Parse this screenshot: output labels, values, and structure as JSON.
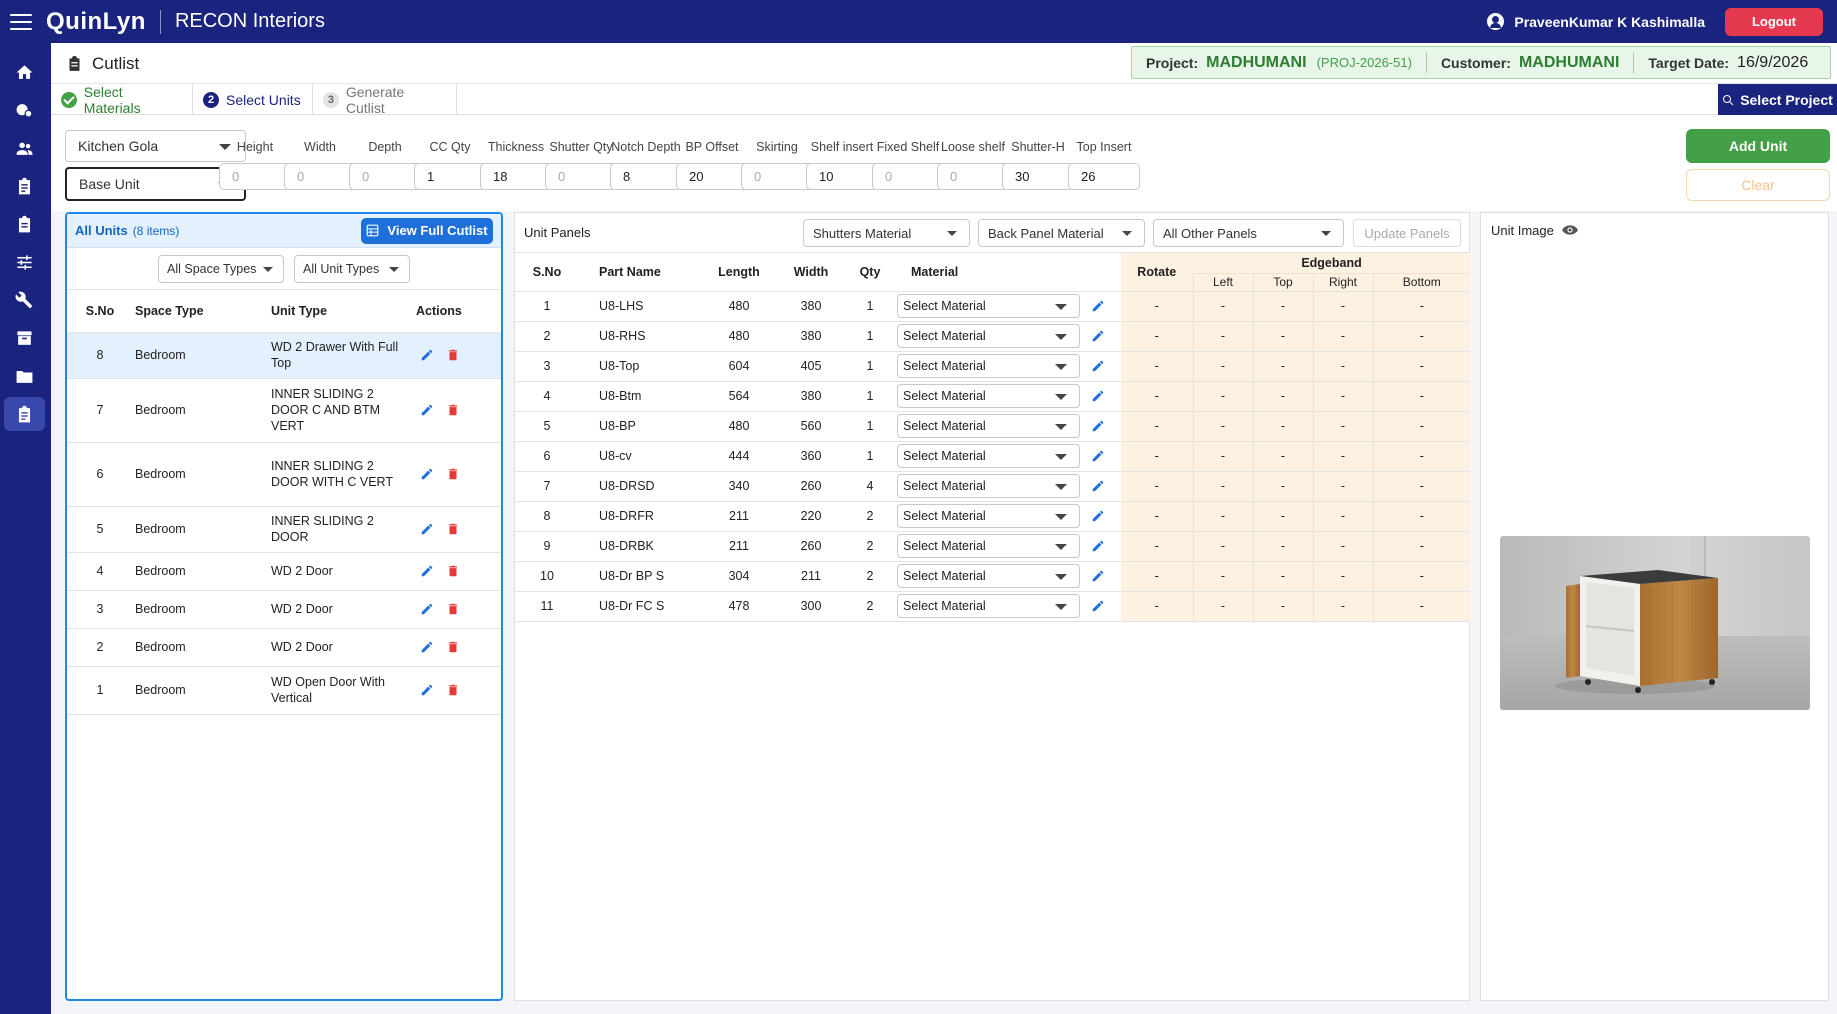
{
  "app": {
    "logo": "QuinLyn",
    "company": "RECON Interiors",
    "user": "PraveenKumar K Kashimalla",
    "logout_label": "Logout"
  },
  "page": {
    "title": "Cutlist"
  },
  "project_info": {
    "project_label": "Project:",
    "project_name": "MADHUMANI",
    "project_code": "(PROJ-2026-51)",
    "customer_label": "Customer:",
    "customer_name": "MADHUMANI",
    "target_label": "Target Date:",
    "target_date": "16/9/2026"
  },
  "steps": [
    {
      "label": "Select Materials",
      "state": "done"
    },
    {
      "num": "2",
      "label": "Select Units",
      "state": "current"
    },
    {
      "num": "3",
      "label": "Generate Cutlist",
      "state": "future"
    }
  ],
  "select_project_label": "Select Project",
  "config": {
    "category": "Kitchen Gola",
    "unit_type": "Base Unit",
    "params": [
      {
        "label": "Height",
        "value": "",
        "placeholder": "0"
      },
      {
        "label": "Width",
        "value": "",
        "placeholder": "0"
      },
      {
        "label": "Depth",
        "value": "",
        "placeholder": "0"
      },
      {
        "label": "CC Qty",
        "value": "1",
        "placeholder": ""
      },
      {
        "label": "Thickness",
        "value": "18",
        "placeholder": ""
      },
      {
        "label": "Shutter Qty",
        "value": "",
        "placeholder": "0"
      },
      {
        "label": "Notch Depth",
        "value": "8",
        "placeholder": ""
      },
      {
        "label": "BP Offset",
        "value": "20",
        "placeholder": ""
      },
      {
        "label": "Skirting",
        "value": "",
        "placeholder": "0"
      },
      {
        "label": "Shelf insert",
        "value": "10",
        "placeholder": ""
      },
      {
        "label": "Fixed Shelf",
        "value": "",
        "placeholder": "0"
      },
      {
        "label": "Loose shelf",
        "value": "",
        "placeholder": "0"
      },
      {
        "label": "Shutter-H",
        "value": "30",
        "placeholder": ""
      },
      {
        "label": "Top Insert",
        "value": "26",
        "placeholder": ""
      }
    ],
    "add_unit_label": "Add Unit",
    "clear_label": "Clear"
  },
  "units_panel": {
    "title": "All Units",
    "count": "(8 items)",
    "view_full_label": "View Full Cutlist",
    "filter_space": "All Space Types",
    "filter_unit": "All Unit Types",
    "columns": [
      "S.No",
      "Space Type",
      "Unit Type",
      "Actions"
    ],
    "rows": [
      {
        "sno": "8",
        "space": "Bedroom",
        "unit": "WD 2 Drawer With Full Top",
        "selected": true
      },
      {
        "sno": "7",
        "space": "Bedroom",
        "unit": "INNER SLIDING 2 DOOR C AND BTM VERT",
        "selected": false
      },
      {
        "sno": "6",
        "space": "Bedroom",
        "unit": "INNER SLIDING 2 DOOR WITH C VERT",
        "selected": false
      },
      {
        "sno": "5",
        "space": "Bedroom",
        "unit": "INNER SLIDING 2 DOOR",
        "selected": false
      },
      {
        "sno": "4",
        "space": "Bedroom",
        "unit": "WD 2 Door",
        "selected": false
      },
      {
        "sno": "3",
        "space": "Bedroom",
        "unit": "WD 2 Door",
        "selected": false
      },
      {
        "sno": "2",
        "space": "Bedroom",
        "unit": "WD 2 Door",
        "selected": false
      },
      {
        "sno": "1",
        "space": "Bedroom",
        "unit": "WD Open Door With Vertical",
        "selected": false
      }
    ]
  },
  "unit_panels": {
    "title": "Unit Panels",
    "shutters_dd": "Shutters Material",
    "back_panel_dd": "Back Panel Material",
    "other_dd": "All Other Panels",
    "update_label": "Update Panels",
    "columns": {
      "sno": "S.No",
      "part": "Part Name",
      "length": "Length",
      "width": "Width",
      "qty": "Qty",
      "material": "Material",
      "rotate": "Rotate",
      "edgeband": "Edgeband",
      "left": "Left",
      "top": "Top",
      "right": "Right",
      "bottom": "Bottom"
    },
    "material_placeholder": "Select Material",
    "rows": [
      {
        "sno": "1",
        "part": "U8-LHS",
        "length": "480",
        "width": "380",
        "qty": "1",
        "rotate": "-",
        "left": "-",
        "top": "-",
        "right": "-",
        "bottom": "-"
      },
      {
        "sno": "2",
        "part": "U8-RHS",
        "length": "480",
        "width": "380",
        "qty": "1",
        "rotate": "-",
        "left": "-",
        "top": "-",
        "right": "-",
        "bottom": "-"
      },
      {
        "sno": "3",
        "part": "U8-Top",
        "length": "604",
        "width": "405",
        "qty": "1",
        "rotate": "-",
        "left": "-",
        "top": "-",
        "right": "-",
        "bottom": "-"
      },
      {
        "sno": "4",
        "part": "U8-Btm",
        "length": "564",
        "width": "380",
        "qty": "1",
        "rotate": "-",
        "left": "-",
        "top": "-",
        "right": "-",
        "bottom": "-"
      },
      {
        "sno": "5",
        "part": "U8-BP",
        "length": "480",
        "width": "560",
        "qty": "1",
        "rotate": "-",
        "left": "-",
        "top": "-",
        "right": "-",
        "bottom": "-"
      },
      {
        "sno": "6",
        "part": "U8-cv",
        "length": "444",
        "width": "360",
        "qty": "1",
        "rotate": "-",
        "left": "-",
        "top": "-",
        "right": "-",
        "bottom": "-"
      },
      {
        "sno": "7",
        "part": "U8-DRSD",
        "length": "340",
        "width": "260",
        "qty": "4",
        "rotate": "-",
        "left": "-",
        "top": "-",
        "right": "-",
        "bottom": "-"
      },
      {
        "sno": "8",
        "part": "U8-DRFR",
        "length": "211",
        "width": "220",
        "qty": "2",
        "rotate": "-",
        "left": "-",
        "top": "-",
        "right": "-",
        "bottom": "-"
      },
      {
        "sno": "9",
        "part": "U8-DRBK",
        "length": "211",
        "width": "260",
        "qty": "2",
        "rotate": "-",
        "left": "-",
        "top": "-",
        "right": "-",
        "bottom": "-"
      },
      {
        "sno": "10",
        "part": "U8-Dr BP S",
        "length": "304",
        "width": "211",
        "qty": "2",
        "rotate": "-",
        "left": "-",
        "top": "-",
        "right": "-",
        "bottom": "-"
      },
      {
        "sno": "11",
        "part": "U8-Dr FC S",
        "length": "478",
        "width": "300",
        "qty": "2",
        "rotate": "-",
        "left": "-",
        "top": "-",
        "right": "-",
        "bottom": "-"
      }
    ]
  },
  "image_panel": {
    "title": "Unit Image"
  },
  "colors": {
    "brand": "#1a237e",
    "success": "#43a047",
    "danger": "#e53950",
    "accent_blue": "#1e88e5",
    "edgeband_bg": "#fdf1e1"
  },
  "icons": {
    "nav": [
      "home-icon",
      "gallery-icon",
      "users-icon",
      "clipboard-icon",
      "assignment-icon",
      "tune-icon",
      "wrench-icon",
      "archive-icon",
      "folder-icon",
      "list-clipboard-icon"
    ],
    "row_edit": "pencil-icon",
    "row_delete": "trash-icon",
    "view": "eye-icon"
  }
}
